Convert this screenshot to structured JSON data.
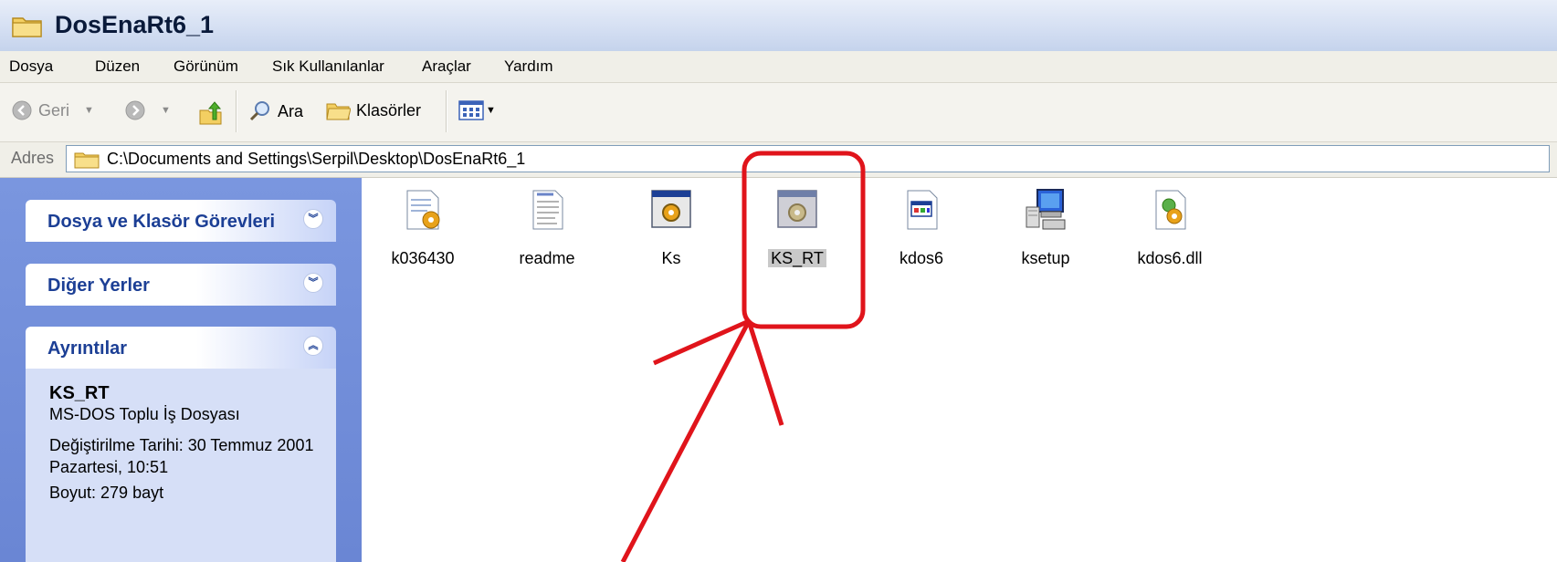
{
  "window": {
    "title": "DosEnaRt6_1"
  },
  "menu": [
    "Dosya",
    "Düzen",
    "Görünüm",
    "Sık Kullanılanlar",
    "Araçlar",
    "Yardım"
  ],
  "toolbar": {
    "back": "Geri",
    "search": "Ara",
    "folders": "Klasörler"
  },
  "address": {
    "label": "Adres",
    "path": "C:\\Documents and Settings\\Serpil\\Desktop\\DosEnaRt6_1"
  },
  "taskpane": {
    "panel1": "Dosya ve Klasör Görevleri",
    "panel2": "Diğer Yerler",
    "panel3": "Ayrıntılar",
    "details": {
      "name": "KS_RT",
      "type": "MS-DOS Toplu İş Dosyası",
      "modified": "Değiştirilme Tarihi: 30 Temmuz 2001 Pazartesi, 10:51",
      "size": "Boyut: 279 bayt"
    }
  },
  "files": [
    {
      "name": "k036430",
      "icon": "setup-info-icon"
    },
    {
      "name": "readme",
      "icon": "text-document-icon"
    },
    {
      "name": "Ks",
      "icon": "batch-file-icon"
    },
    {
      "name": "KS_RT",
      "icon": "batch-file-icon",
      "selected": true
    },
    {
      "name": "kdos6",
      "icon": "executable-icon"
    },
    {
      "name": "ksetup",
      "icon": "installer-icon"
    },
    {
      "name": "kdos6.dll",
      "icon": "dll-file-icon"
    }
  ],
  "colors": {
    "annotation": "#e0141b",
    "pane": "#6e8bd7",
    "panelTitle": "#1c3f95"
  }
}
